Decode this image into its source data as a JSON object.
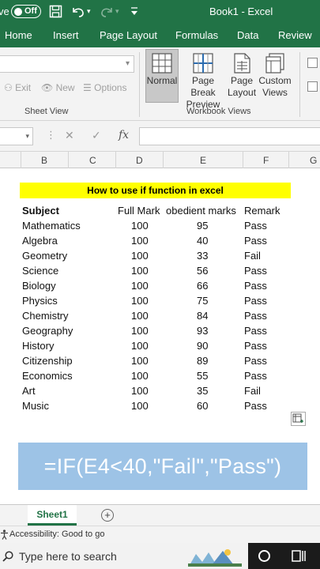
{
  "titlebar": {
    "autosave_fragment": "ve",
    "toggle_label": "Off",
    "title": "Book1  -  Excel"
  },
  "ribbon_tabs": [
    "Home",
    "Insert",
    "Page Layout",
    "Formulas",
    "Data",
    "Review"
  ],
  "sheet_view": {
    "exit_label": "Exit",
    "new_label": "New",
    "options_label": "Options",
    "group_label": "Sheet View"
  },
  "workbook_views": {
    "normal_label": "Normal",
    "page_break_line1": "Page Break",
    "page_break_line2": "Preview",
    "page_layout_line1": "Page",
    "page_layout_line2": "Layout",
    "custom_line1": "Custom",
    "custom_line2": "Views",
    "group_label": "Workbook Views"
  },
  "formula_bar": {
    "fx_label": "fx",
    "content": ""
  },
  "columns": [
    "B",
    "C",
    "D",
    "E",
    "F",
    "G"
  ],
  "sheet": {
    "banner": "How to use if function in excel",
    "headers": [
      "Subject",
      "Full Mark",
      "obedient marks",
      "Remark"
    ],
    "rows": [
      [
        "Mathematics",
        "100",
        "95",
        "Pass"
      ],
      [
        "Algebra",
        "100",
        "40",
        "Pass"
      ],
      [
        "Geometry",
        "100",
        "33",
        "Fail"
      ],
      [
        "Science",
        "100",
        "56",
        "Pass"
      ],
      [
        "Biology",
        "100",
        "66",
        "Pass"
      ],
      [
        "Physics",
        "100",
        "75",
        "Pass"
      ],
      [
        "Chemistry",
        "100",
        "84",
        "Pass"
      ],
      [
        "Geography",
        "100",
        "93",
        "Pass"
      ],
      [
        "History",
        "100",
        "90",
        "Pass"
      ],
      [
        "Citizenship",
        "100",
        "89",
        "Pass"
      ],
      [
        "Economics",
        "100",
        "55",
        "Pass"
      ],
      [
        "Art",
        "100",
        "35",
        "Fail"
      ],
      [
        "Music",
        "100",
        "60",
        "Pass"
      ]
    ],
    "formula_overlay": "=IF(E4<40,\"Fail\",\"Pass\")"
  },
  "sheet_tabs": {
    "active": "Sheet1",
    "add_label": "+"
  },
  "status": {
    "accessibility": "Accessibility: Good to go"
  },
  "taskbar": {
    "search_placeholder": "Type here to search"
  },
  "colors": {
    "excel_green": "#217346",
    "banner_yellow": "#ffff00",
    "overlay_blue": "#9dc3e6"
  }
}
